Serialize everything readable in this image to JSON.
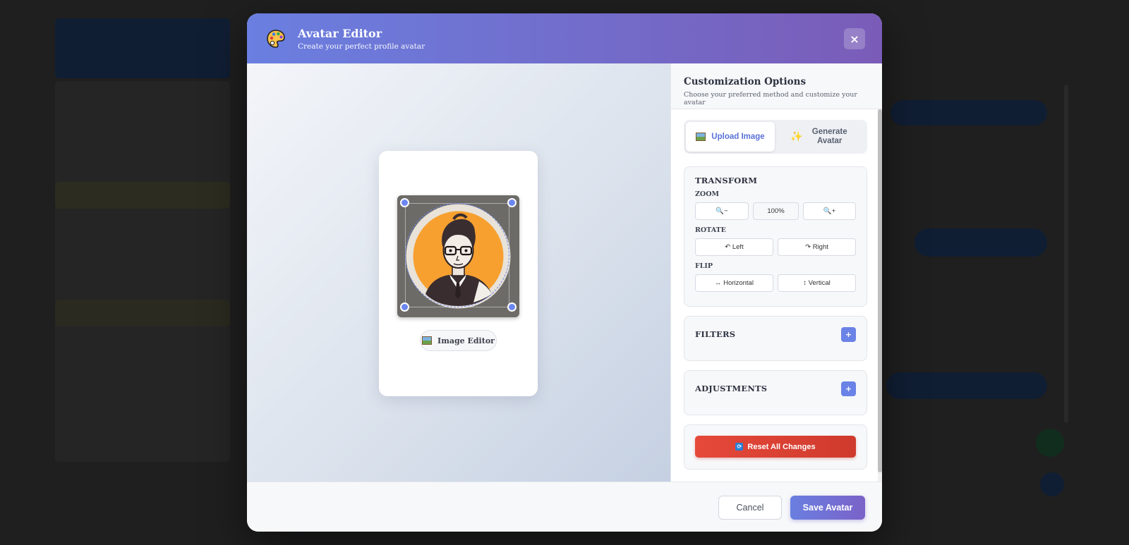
{
  "header": {
    "title": "Avatar Editor",
    "subtitle": "Create your perfect profile avatar",
    "close_label": "×"
  },
  "preview": {
    "editor_label": "Image Editor"
  },
  "options": {
    "title": "Customization Options",
    "subtitle": "Choose your preferred method and customize your avatar",
    "tabs": [
      {
        "label": "Upload Image",
        "icon": "image-icon",
        "active": true
      },
      {
        "label": "Generate Avatar",
        "icon": "sparkle-icon",
        "active": false
      }
    ],
    "transform": {
      "title": "TRANSFORM",
      "zoom_label": "ZOOM",
      "zoom_out": "🔍−",
      "zoom_value": "100%",
      "zoom_in": "🔍+",
      "rotate_label": "ROTATE",
      "rotate_left": "↶ Left",
      "rotate_right": "↷ Right",
      "flip_label": "FLIP",
      "flip_horizontal": "↔ Horizontal",
      "flip_vertical": "↕ Vertical"
    },
    "filters": {
      "title": "FILTERS",
      "toggle": "+"
    },
    "adjustments": {
      "title": "ADJUSTMENTS",
      "toggle": "+"
    },
    "reset_label": "Reset All Changes"
  },
  "footer": {
    "cancel_label": "Cancel",
    "save_label": "Save Avatar"
  },
  "colors": {
    "accent": "#6a7fe0",
    "header_gradient_end": "#7a5cb8",
    "danger": "#e5493a",
    "avatar_background": "#f7a030"
  }
}
